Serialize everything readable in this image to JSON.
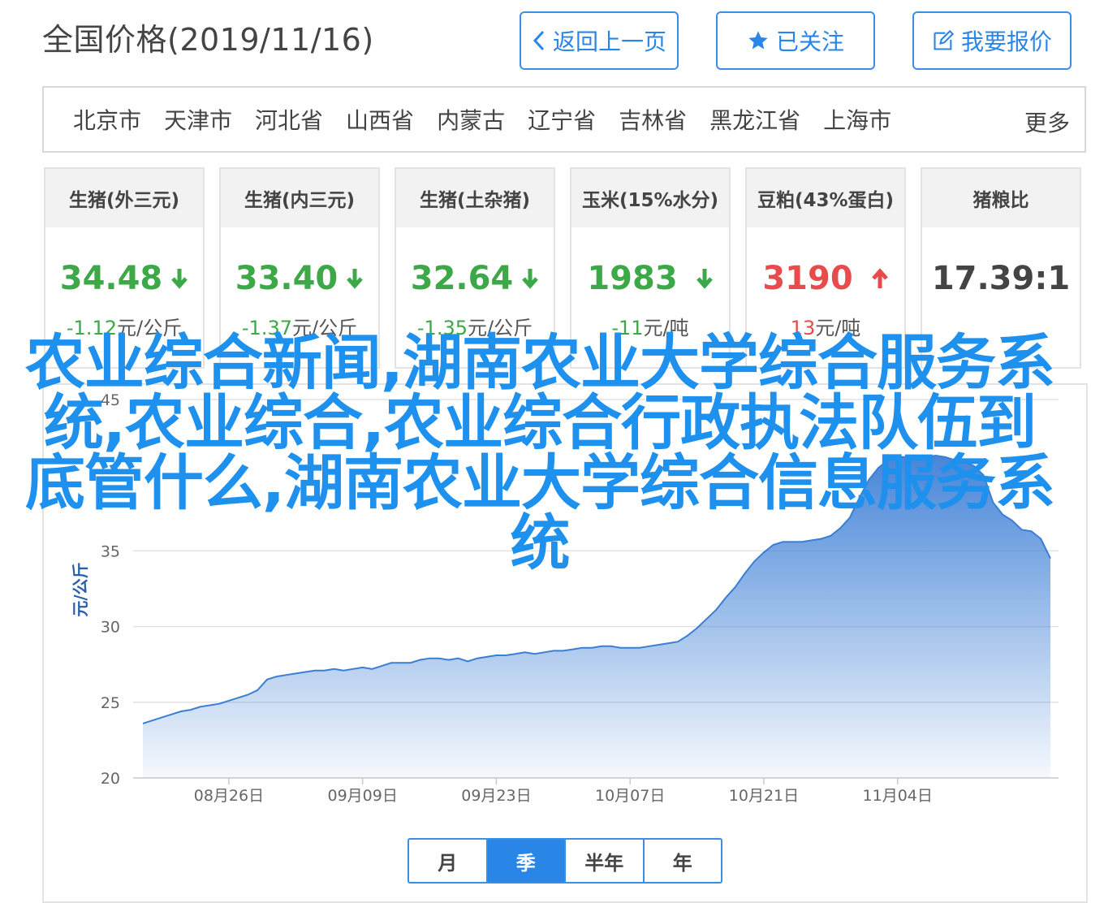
{
  "header": {
    "title": "全国价格(2019/11/16)",
    "buttons": [
      {
        "label": "返回上一页",
        "icon": "chevron-left-icon"
      },
      {
        "label": "已关注",
        "icon": "star-icon"
      },
      {
        "label": "我要报价",
        "icon": "edit-icon"
      }
    ]
  },
  "regions": {
    "items": [
      "北京市",
      "天津市",
      "河北省",
      "山西省",
      "内蒙古",
      "辽宁省",
      "吉林省",
      "黑龙江省",
      "上海市"
    ],
    "more": "更多"
  },
  "cards": [
    {
      "name": "生猪(外三元)",
      "value": "34.48",
      "trend": "down",
      "change": "-1.12",
      "unit": "元/公斤"
    },
    {
      "name": "生猪(内三元)",
      "value": "33.40",
      "trend": "down",
      "change": "-1.37",
      "unit": "元/公斤"
    },
    {
      "name": "生猪(土杂猪)",
      "value": "32.64",
      "trend": "down",
      "change": "-1.35",
      "unit": "元/公斤"
    },
    {
      "name": "玉米(15%水分)",
      "value": "1983",
      "trend": "down",
      "change": "-11",
      "unit": "元/吨"
    },
    {
      "name": "豆粕(43%蛋白)",
      "value": "3190",
      "trend": "up",
      "change": "13",
      "unit": "元/吨"
    },
    {
      "name": "猪粮比",
      "value": "17.39:1",
      "trend": "none",
      "change": "",
      "unit": ""
    }
  ],
  "colors": {
    "down": "#3da847",
    "up": "#e84b4b",
    "accent": "#2a86e6",
    "line": "#3a7fd5"
  },
  "chart_data": {
    "type": "area",
    "ylabel": "元/公斤",
    "ylim": [
      20,
      45
    ],
    "yticks": [
      20,
      25,
      30,
      35,
      45
    ],
    "xticks": [
      "08月26日",
      "09月09日",
      "09月23日",
      "10月07日",
      "10月21日",
      "11月04日"
    ],
    "grid": true,
    "x_start": "08月17日",
    "x_end": "11月16日",
    "values": [
      23.6,
      23.8,
      24.0,
      24.2,
      24.4,
      24.5,
      24.7,
      24.8,
      24.9,
      25.1,
      25.3,
      25.5,
      25.8,
      26.5,
      26.7,
      26.8,
      26.9,
      27.0,
      27.1,
      27.1,
      27.2,
      27.1,
      27.2,
      27.3,
      27.2,
      27.4,
      27.6,
      27.6,
      27.6,
      27.8,
      27.9,
      27.9,
      27.8,
      27.9,
      27.7,
      27.9,
      28.0,
      28.1,
      28.1,
      28.2,
      28.3,
      28.2,
      28.3,
      28.4,
      28.4,
      28.5,
      28.6,
      28.6,
      28.7,
      28.7,
      28.6,
      28.6,
      28.6,
      28.7,
      28.8,
      28.9,
      29.0,
      29.4,
      29.9,
      30.5,
      31.1,
      31.9,
      32.6,
      33.5,
      34.3,
      34.9,
      35.4,
      35.6,
      35.6,
      35.6,
      35.7,
      35.8,
      36.0,
      36.5,
      37.2,
      38.5,
      39.7,
      40.5,
      41.0,
      41.2,
      41.2,
      41.3,
      41.2,
      41.3,
      41.2,
      41.0,
      40.9,
      40.6,
      40.0,
      38.2,
      37.4,
      37.0,
      36.4,
      36.3,
      35.8,
      34.5
    ]
  },
  "period_tabs": {
    "items": [
      "月",
      "季",
      "半年",
      "年"
    ],
    "active": "季"
  },
  "overlay_text": "农业综合新闻,湖南农业大学综合服务系统,农业综合,农业综合行政执法队伍到底管什么,湖南农业大学综合信息服务系统"
}
